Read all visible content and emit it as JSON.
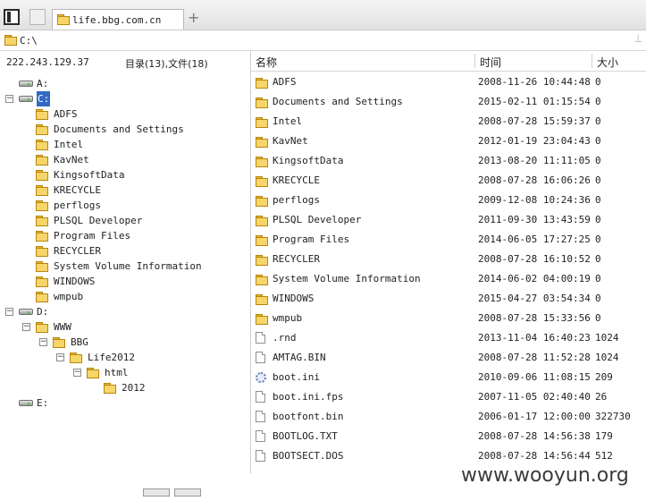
{
  "tab": {
    "title": "life.bbg.com.cn",
    "new_tab": "+"
  },
  "address": {
    "path": "C:\\",
    "button": "⊥"
  },
  "left": {
    "ip": "222.243.129.37",
    "counts": "目录(13),文件(18)"
  },
  "tree": [
    {
      "label": "A:",
      "type": "drive",
      "indent": 0,
      "exp": ""
    },
    {
      "label": "C:",
      "type": "drive",
      "indent": 0,
      "exp": "−",
      "selected": true
    },
    {
      "label": "ADFS",
      "type": "folder",
      "indent": 1,
      "exp": ""
    },
    {
      "label": "Documents and Settings",
      "type": "folder",
      "indent": 1,
      "exp": ""
    },
    {
      "label": "Intel",
      "type": "folder",
      "indent": 1,
      "exp": ""
    },
    {
      "label": "KavNet",
      "type": "folder",
      "indent": 1,
      "exp": ""
    },
    {
      "label": "KingsoftData",
      "type": "folder",
      "indent": 1,
      "exp": ""
    },
    {
      "label": "KRECYCLE",
      "type": "folder",
      "indent": 1,
      "exp": ""
    },
    {
      "label": "perflogs",
      "type": "folder",
      "indent": 1,
      "exp": ""
    },
    {
      "label": "PLSQL Developer",
      "type": "folder",
      "indent": 1,
      "exp": ""
    },
    {
      "label": "Program Files",
      "type": "folder",
      "indent": 1,
      "exp": ""
    },
    {
      "label": "RECYCLER",
      "type": "folder",
      "indent": 1,
      "exp": ""
    },
    {
      "label": "System Volume Information",
      "type": "folder",
      "indent": 1,
      "exp": ""
    },
    {
      "label": "WINDOWS",
      "type": "folder",
      "indent": 1,
      "exp": ""
    },
    {
      "label": "wmpub",
      "type": "folder",
      "indent": 1,
      "exp": ""
    },
    {
      "label": "D:",
      "type": "drive",
      "indent": 0,
      "exp": "−"
    },
    {
      "label": "WWW",
      "type": "folder",
      "indent": 1,
      "exp": "−"
    },
    {
      "label": "BBG",
      "type": "folder",
      "indent": 2,
      "exp": "−"
    },
    {
      "label": "Life2012",
      "type": "folder",
      "indent": 3,
      "exp": "−"
    },
    {
      "label": "html",
      "type": "folder",
      "indent": 4,
      "exp": "−"
    },
    {
      "label": "2012",
      "type": "folder",
      "indent": 5,
      "exp": ""
    },
    {
      "label": "E:",
      "type": "drive",
      "indent": 0,
      "exp": ""
    }
  ],
  "columns": {
    "name": "名称",
    "time": "时间",
    "size": "大小"
  },
  "files": [
    {
      "name": "ADFS",
      "time": "2008-11-26 10:44:48",
      "size": "0",
      "icon": "folder"
    },
    {
      "name": "Documents and Settings",
      "time": "2015-02-11 01:15:54",
      "size": "0",
      "icon": "folder"
    },
    {
      "name": "Intel",
      "time": "2008-07-28 15:59:37",
      "size": "0",
      "icon": "folder"
    },
    {
      "name": "KavNet",
      "time": "2012-01-19 23:04:43",
      "size": "0",
      "icon": "folder"
    },
    {
      "name": "KingsoftData",
      "time": "2013-08-20 11:11:05",
      "size": "0",
      "icon": "folder"
    },
    {
      "name": "KRECYCLE",
      "time": "2008-07-28 16:06:26",
      "size": "0",
      "icon": "folder"
    },
    {
      "name": "perflogs",
      "time": "2009-12-08 10:24:36",
      "size": "0",
      "icon": "folder"
    },
    {
      "name": "PLSQL Developer",
      "time": "2011-09-30 13:43:59",
      "size": "0",
      "icon": "folder"
    },
    {
      "name": "Program Files",
      "time": "2014-06-05 17:27:25",
      "size": "0",
      "icon": "folder"
    },
    {
      "name": "RECYCLER",
      "time": "2008-07-28 16:10:52",
      "size": "0",
      "icon": "folder"
    },
    {
      "name": "System Volume Information",
      "time": "2014-06-02 04:00:19",
      "size": "0",
      "icon": "folder"
    },
    {
      "name": "WINDOWS",
      "time": "2015-04-27 03:54:34",
      "size": "0",
      "icon": "folder"
    },
    {
      "name": "wmpub",
      "time": "2008-07-28 15:33:56",
      "size": "0",
      "icon": "folder"
    },
    {
      "name": ".rnd",
      "time": "2013-11-04 16:40:23",
      "size": "1024",
      "icon": "file"
    },
    {
      "name": "AMTAG.BIN",
      "time": "2008-07-28 11:52:28",
      "size": "1024",
      "icon": "file"
    },
    {
      "name": "boot.ini",
      "time": "2010-09-06 11:08:15",
      "size": "209",
      "icon": "settings"
    },
    {
      "name": "boot.ini.fps",
      "time": "2007-11-05 02:40:40",
      "size": "26",
      "icon": "file"
    },
    {
      "name": "bootfont.bin",
      "time": "2006-01-17 12:00:00",
      "size": "322730",
      "icon": "file"
    },
    {
      "name": "BOOTLOG.TXT",
      "time": "2008-07-28 14:56:38",
      "size": "179",
      "icon": "file"
    },
    {
      "name": "BOOTSECT.DOS",
      "time": "2008-07-28 14:56:44",
      "size": "512",
      "icon": "file"
    }
  ],
  "watermark": "www.wooyun.org"
}
